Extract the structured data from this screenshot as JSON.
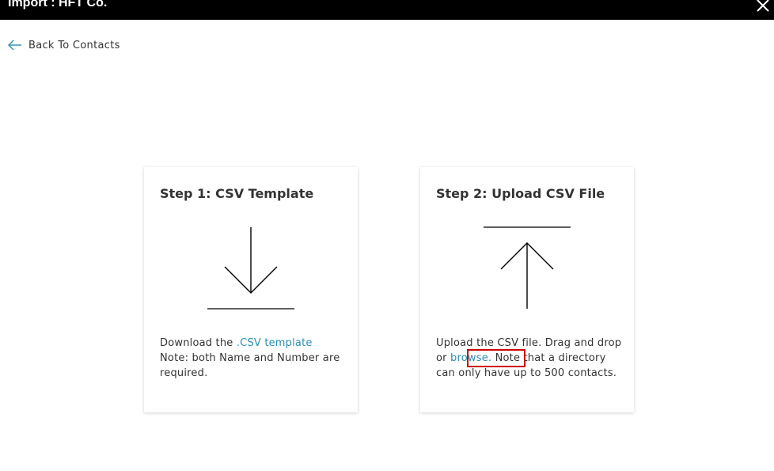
{
  "window": {
    "title": "Import : HFT Co.",
    "close_icon": "close-icon"
  },
  "nav": {
    "back_label": "Back To Contacts",
    "back_icon": "arrow-left-icon"
  },
  "colors": {
    "topbar_bg": "#000000",
    "link": "#2a8fb4",
    "highlight": "#cc0000"
  },
  "step1": {
    "title": "Step 1: CSV Template",
    "icon": "download-icon",
    "text_before_link": "Download the ",
    "link_text": ".CSV template",
    "note": "Note: both Name and Number are required."
  },
  "step2": {
    "title": "Step 2: Upload CSV File",
    "icon": "upload-icon",
    "text_before_link": "Upload the CSV file. Drag and drop or ",
    "link_text": "browse.",
    "text_after_link": " Note that a directory can only have up to 500 contacts."
  }
}
